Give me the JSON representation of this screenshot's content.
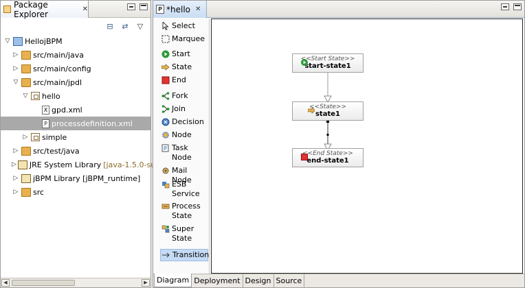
{
  "package_explorer": {
    "title": "Package Explorer",
    "tree": [
      {
        "label": "HellojBPM",
        "level": 0,
        "expanded": true,
        "icon": "project-icon"
      },
      {
        "label": "src/main/java",
        "level": 1,
        "expanded": false,
        "icon": "source-folder-icon"
      },
      {
        "label": "src/main/config",
        "level": 1,
        "expanded": false,
        "icon": "source-folder-icon"
      },
      {
        "label": "src/main/jpdl",
        "level": 1,
        "expanded": true,
        "icon": "source-folder-icon"
      },
      {
        "label": "hello",
        "level": 2,
        "expanded": true,
        "icon": "package-icon"
      },
      {
        "label": "gpd.xml",
        "level": 3,
        "icon": "xml-file-icon"
      },
      {
        "label": "processdefinition.xml",
        "level": 3,
        "icon": "process-file-icon",
        "selected": true
      },
      {
        "label": "simple",
        "level": 2,
        "expanded": false,
        "icon": "package-icon"
      },
      {
        "label": "src/test/java",
        "level": 1,
        "expanded": false,
        "icon": "source-folder-icon"
      },
      {
        "label": "JRE System Library",
        "suffix": "[java-1.5.0-su",
        "level": 1,
        "expanded": false,
        "icon": "library-icon"
      },
      {
        "label": "jBPM Library [jBPM_runtime]",
        "level": 1,
        "expanded": false,
        "icon": "library-icon"
      },
      {
        "label": "src",
        "level": 1,
        "expanded": false,
        "icon": "folder-icon"
      }
    ]
  },
  "editor": {
    "tab_title": "*hello",
    "palette": [
      {
        "label": "Select",
        "icon": "arrow-icon"
      },
      {
        "label": "Marquee",
        "icon": "marquee-icon"
      },
      {
        "label": "Start",
        "icon": "start-icon"
      },
      {
        "label": "State",
        "icon": "state-icon"
      },
      {
        "label": "End",
        "icon": "end-icon"
      },
      {
        "label": "Fork",
        "icon": "fork-icon"
      },
      {
        "label": "Join",
        "icon": "join-icon"
      },
      {
        "label": "Decision",
        "icon": "decision-icon"
      },
      {
        "label": "Node",
        "icon": "node-icon"
      },
      {
        "label": "Task\nNode",
        "icon": "task-node-icon"
      },
      {
        "label": "Mail Node",
        "icon": "mail-node-icon"
      },
      {
        "label": "ESB\nService",
        "icon": "esb-service-icon"
      },
      {
        "label": "Process\nState",
        "icon": "process-state-icon"
      },
      {
        "label": "Super\nState",
        "icon": "super-state-icon"
      },
      {
        "label": "Transition",
        "icon": "transition-icon",
        "active": true
      }
    ],
    "nodes": [
      {
        "stereotype": "<<Start State>>",
        "name": "start-state1",
        "icon": "start-icon"
      },
      {
        "stereotype": "<<State>>",
        "name": "state1",
        "icon": "state-icon"
      },
      {
        "stereotype": "<<End State>>",
        "name": "end-state1",
        "icon": "end-icon"
      }
    ],
    "bottom_tabs": [
      "Diagram",
      "Deployment",
      "Design",
      "Source"
    ],
    "active_bottom_tab": "Diagram"
  },
  "colors": {
    "start_green": "#2a9a34",
    "end_red": "#e23232",
    "selection": "#a9a9a9",
    "palette_active": "#c5dbf5"
  }
}
